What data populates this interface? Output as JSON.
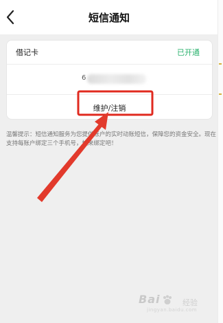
{
  "header": {
    "title": "短信通知",
    "back_icon": "chevron-left-icon"
  },
  "card": {
    "label": "借记卡",
    "status": "已开通",
    "status_color": "#2bb26e",
    "phone_prefix": "6",
    "action_label": "维护/注销"
  },
  "tip": {
    "text": "温馨提示：短信通知服务为您提供账户的实时动账短信，保障您的资金安全。现在支持每账户绑定三个手机号，快来绑定吧！"
  },
  "annotation": {
    "highlight_color": "#e02a1f"
  },
  "watermark": {
    "logo": "Bai 经验",
    "sub": "经验",
    "url": "jingyan.baidu.com"
  }
}
